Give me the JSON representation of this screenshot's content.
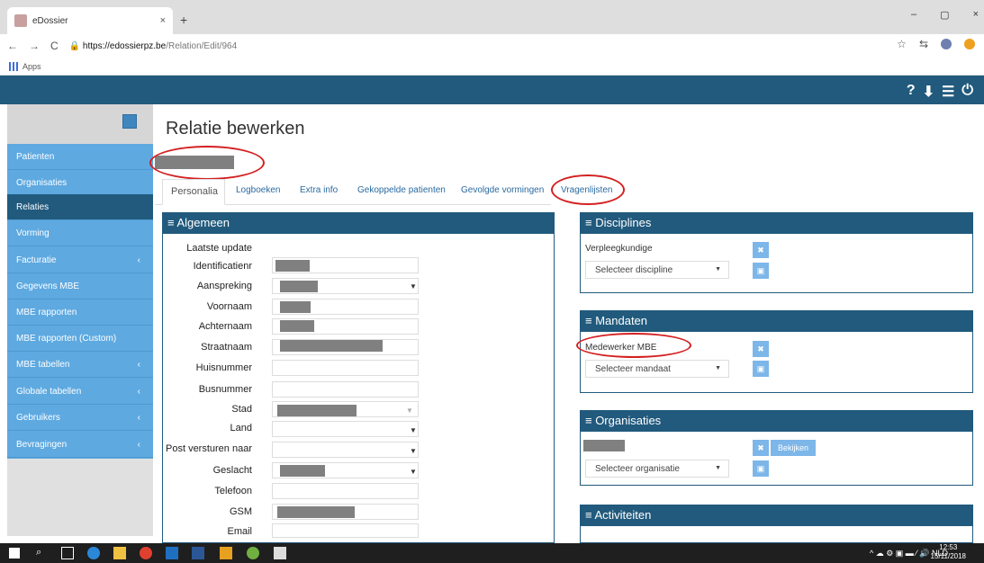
{
  "browser": {
    "tab_title": "eDossier",
    "tab_close": "×",
    "new_tab": "+",
    "url_host": "https://edossierpz.be",
    "url_path": "/Relation/Edit/964",
    "bookmarks_label": "Apps",
    "window_controls": [
      "–",
      "▢",
      "×"
    ]
  },
  "sidebar": {
    "items": [
      {
        "label": "Patienten",
        "chevron": ""
      },
      {
        "label": "Organisaties",
        "chevron": ""
      },
      {
        "label": "Relaties",
        "chevron": "",
        "active": true
      },
      {
        "label": "Vorming",
        "chevron": ""
      },
      {
        "label": "Facturatie",
        "chevron": "‹"
      },
      {
        "label": "Gegevens MBE",
        "chevron": ""
      },
      {
        "label": "MBE rapporten",
        "chevron": ""
      },
      {
        "label": "MBE rapporten (Custom)",
        "chevron": ""
      },
      {
        "label": "MBE tabellen",
        "chevron": "‹"
      },
      {
        "label": "Globale tabellen",
        "chevron": "‹"
      },
      {
        "label": "Gebruikers",
        "chevron": "‹"
      },
      {
        "label": "Bevragingen",
        "chevron": "‹"
      }
    ]
  },
  "page": {
    "title": "Relatie bewerken",
    "tabs": [
      "Personalia",
      "Logboeken",
      "Extra info",
      "Gekoppelde patienten",
      "Gevolgde vormingen",
      "Vragenlijsten"
    ]
  },
  "algemeen": {
    "title": "≡ Algemeen",
    "fields": [
      "Laatste update",
      "Identificatienr",
      "Aanspreking",
      "Voornaam",
      "Achternaam",
      "Straatnaam",
      "Huisnummer",
      "Busnummer",
      "Stad",
      "Land",
      "Post versturen naar",
      "Geslacht",
      "Telefoon",
      "GSM",
      "Email"
    ]
  },
  "disciplines": {
    "title": "≡ Disciplines",
    "item": "Verpleegkundige",
    "select": "Selecteer discipline"
  },
  "mandaten": {
    "title": "≡ Mandaten",
    "item": "Medewerker MBE",
    "select": "Selecteer mandaat"
  },
  "organisaties": {
    "title": "≡ Organisaties",
    "view_button": "Bekijken",
    "select": "Selecteer organisatie"
  },
  "activiteiten": {
    "title": "≡ Activiteiten"
  },
  "taskbar": {
    "tray": "^ ☁ ⚙ ▣ ▬ ⁄ 🔊 NLD",
    "time": "12:53",
    "date": "15/11/2018"
  },
  "colors": {
    "header": "#215a7d",
    "sidebar": "#5ea9e0",
    "annotation": "#d42020"
  }
}
